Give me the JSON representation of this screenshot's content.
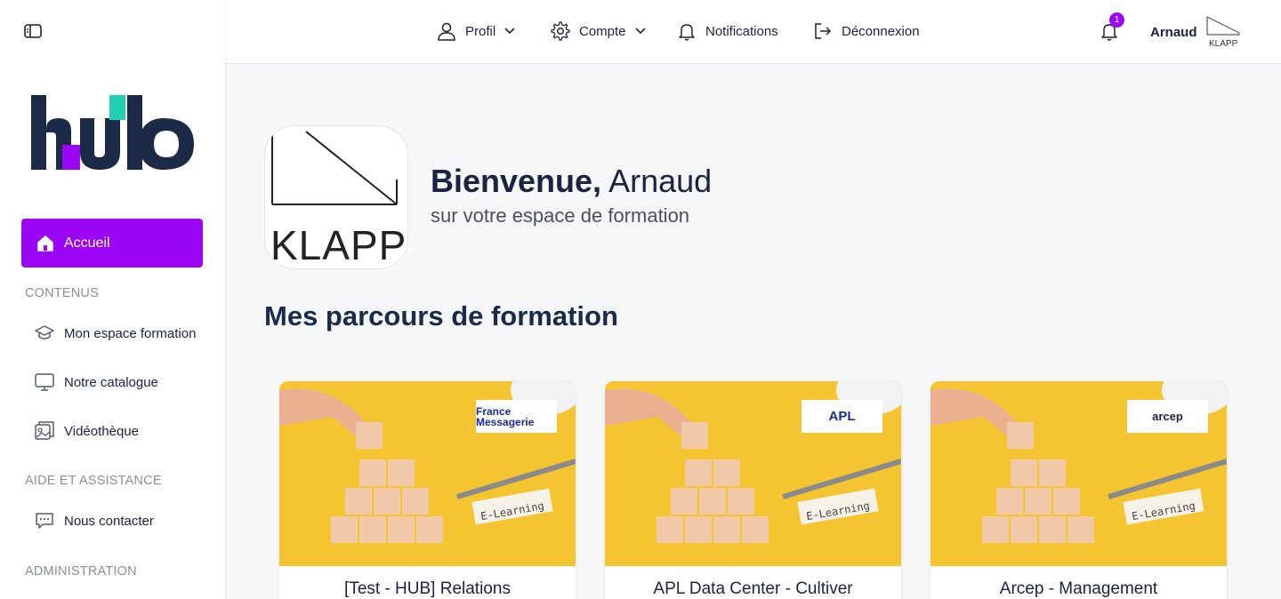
{
  "nav": {
    "home": "Accueil",
    "sections": [
      {
        "label": "CONTENUS"
      },
      {
        "label": "AIDE ET ASSISTANCE"
      },
      {
        "label": "ADMINISTRATION"
      }
    ],
    "items": [
      {
        "label": "Mon espace formation",
        "icon": "graduation-cap-icon"
      },
      {
        "label": "Notre catalogue",
        "icon": "monitor-icon"
      },
      {
        "label": "Vidéothèque",
        "icon": "video-library-icon"
      },
      {
        "label": "Nous contacter",
        "icon": "chat-bubble-icon"
      }
    ],
    "logo_text": "hub"
  },
  "topbar": {
    "profil": "Profil",
    "compte": "Compte",
    "notifications": "Notifications",
    "deconnexion": "Déconnexion",
    "notification_count": "1",
    "user_name": "Arnaud",
    "org_logo_text": "KLAPP"
  },
  "main": {
    "welcome_bold": "Bienvenue,",
    "welcome_name": " Arnaud",
    "subtitle": "sur votre espace de formation",
    "org_logo_text": "KLAPP",
    "section_title": "Mes parcours de formation",
    "courses": [
      {
        "title": "[Test - HUB] Relations",
        "partner": "France Messagerie",
        "image_text": "E-Learning"
      },
      {
        "title": "APL Data Center - Cultiver",
        "partner": "APL",
        "image_text": "E-Learning"
      },
      {
        "title": "Arcep - Management",
        "partner": "arcep",
        "image_text": "E-Learning"
      }
    ]
  },
  "colors": {
    "accent": "#9b06f5",
    "navy": "#1a2340",
    "teal": "#1fd1b0",
    "card_bg": "#f5c431"
  }
}
